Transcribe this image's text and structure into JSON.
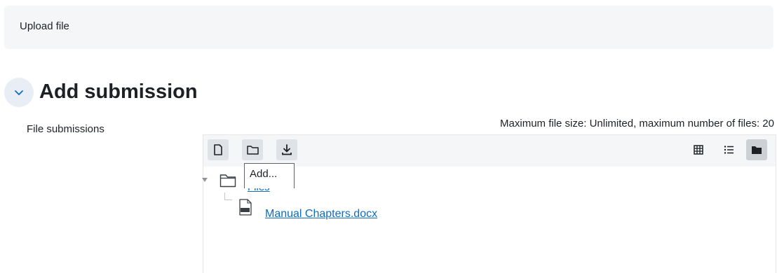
{
  "banner": {
    "text": "Upload file"
  },
  "section": {
    "title": "Add submission",
    "toggle_icon": "chevron-down-icon"
  },
  "field": {
    "label": "File submissions"
  },
  "filepicker": {
    "limits": "Maximum file size: Unlimited, maximum number of files: 20",
    "toolbar": {
      "left_icons": [
        "add-file-icon",
        "create-folder-icon",
        "download-icon"
      ],
      "right_icons": [
        "grid-view-icon",
        "list-view-icon",
        "tree-view-icon"
      ],
      "active_view": "tree-view-icon"
    },
    "tooltip": "Add...",
    "tree": {
      "root_label": "Files",
      "files": [
        {
          "name": "Manual Chapters.docx",
          "icon": "docx-file-icon"
        }
      ]
    }
  },
  "colors": {
    "link": "#0f6cbf",
    "banner_bg": "#f5f6f8",
    "toolbar_bg": "#f5f6f8"
  }
}
